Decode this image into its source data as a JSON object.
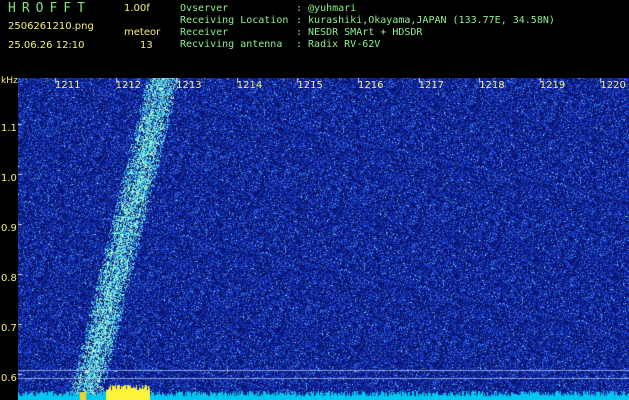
{
  "header": {
    "title": "HROFFT",
    "version": "1.00f",
    "filename": "2506261210.png",
    "timestamp": "25.06.26 12:10",
    "mode_label": "meteor",
    "count": "13"
  },
  "station": [
    {
      "label": "Ovserver",
      "value": ": @yuhmari"
    },
    {
      "label": "Receiving Location",
      "value": ": kurashiki,Okayama,JAPAN (133.77E, 34.58N)"
    },
    {
      "label": "Receiver",
      "value": ": NESDR SMArt + HDSDR"
    },
    {
      "label": "Recviving antenna",
      "value": ": Radix RV-62V"
    }
  ],
  "spectrogram": {
    "x_unit": "",
    "x_ticks": [
      "1211",
      "1212",
      "1213",
      "1214",
      "1215",
      "1216",
      "1217",
      "1218",
      "1219",
      "1220"
    ],
    "y_unit": "kHz",
    "y_ticks": [
      "1.1",
      "1.0",
      "0.9",
      "0.8",
      "0.7",
      "0.6"
    ],
    "colors": {
      "background": "#0a1a7a",
      "noise": "#2a4fd0",
      "trail": "#9ef0d0",
      "floor": "#00c8f0",
      "burst": "#fff23a"
    }
  }
}
